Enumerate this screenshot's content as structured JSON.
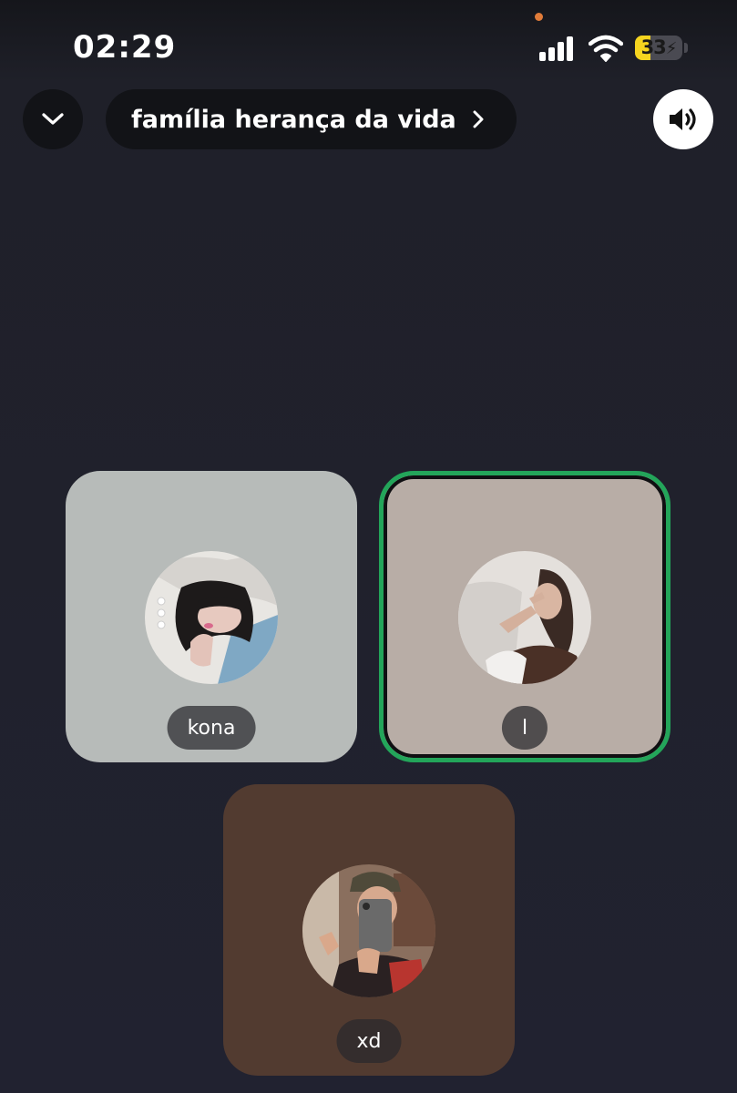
{
  "status_bar": {
    "time": "02:29",
    "battery": "33",
    "battery_percent": 33
  },
  "header": {
    "back_icon": "chevron-down-icon",
    "title": "família herança da vida",
    "title_icon": "chevron-right-icon",
    "speaker_icon": "speaker-icon"
  },
  "participants": [
    {
      "name": "kona",
      "speaking": false
    },
    {
      "name": "l",
      "speaking": true
    },
    {
      "name": "xd",
      "speaking": false
    }
  ],
  "colors": {
    "background": "#1f2028",
    "speaking_border": "#23a55a",
    "battery": "#f5d41f",
    "orange_dot": "#e07b39"
  }
}
